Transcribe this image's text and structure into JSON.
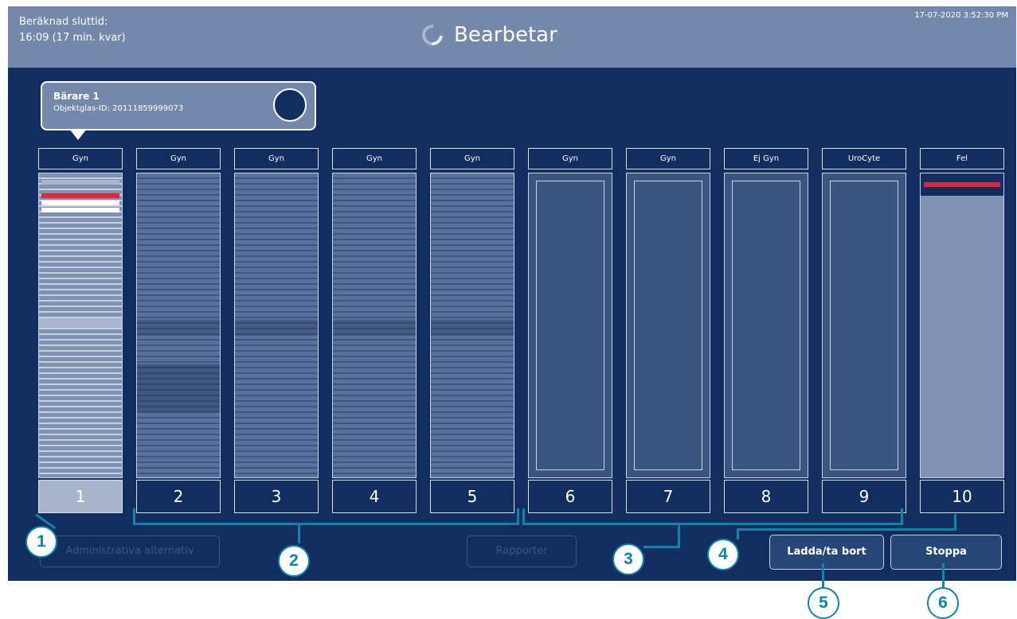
{
  "header": {
    "eta_label": "Beräknad sluttid:",
    "eta_value": "16:09 (17 min. kvar)",
    "status": "Bearbetar",
    "datetime": "17-07-2020 3:52:30 PM"
  },
  "tooltip": {
    "title": "Bärare 1",
    "subtitle": "Objektglas-ID: 20111859999073"
  },
  "racks": [
    {
      "number": "1",
      "type": "Gyn",
      "state": "processing"
    },
    {
      "number": "2",
      "type": "Gyn",
      "state": "loaded"
    },
    {
      "number": "3",
      "type": "Gyn",
      "state": "loaded"
    },
    {
      "number": "4",
      "type": "Gyn",
      "state": "loaded"
    },
    {
      "number": "5",
      "type": "Gyn",
      "state": "loaded"
    },
    {
      "number": "6",
      "type": "Gyn",
      "state": "empty"
    },
    {
      "number": "7",
      "type": "Gyn",
      "state": "empty"
    },
    {
      "number": "8",
      "type": "Ej Gyn",
      "state": "empty"
    },
    {
      "number": "9",
      "type": "UroCyte",
      "state": "empty"
    },
    {
      "number": "10",
      "type": "Fel",
      "state": "error"
    }
  ],
  "buttons": {
    "admin": "Administrativa alternativ",
    "reports": "Rapporter",
    "load_remove": "Ladda/ta bort",
    "stop": "Stoppa"
  },
  "callouts": [
    "1",
    "2",
    "3",
    "4",
    "5",
    "6"
  ],
  "colors": {
    "background": "#122d5f",
    "header": "#7388ab",
    "error_red": "#e0283d",
    "callout": "#0f86a8"
  }
}
